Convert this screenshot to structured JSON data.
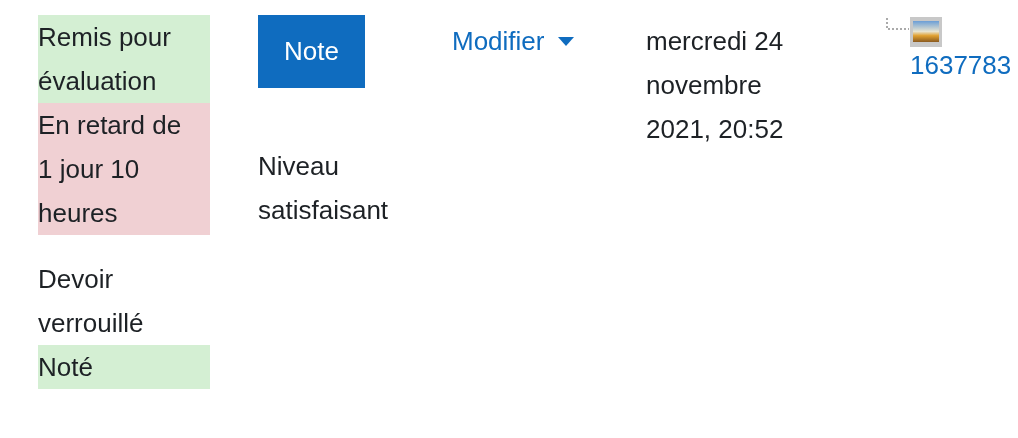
{
  "status_groups": [
    [
      {
        "text": "Remis pour évaluation",
        "color": "#d4efd3"
      },
      {
        "text": "En retard de 1 jour 10 heures",
        "color": "#f0d0d3"
      }
    ],
    [
      {
        "text": "Devoir verrouillé"
      },
      {
        "text": "Noté",
        "color": "#d4efd3"
      }
    ]
  ],
  "grade": {
    "button": "Note",
    "feedback": "Niveau satisfaisant"
  },
  "edit_menu": {
    "label": "Modifier"
  },
  "last_modified": "mercredi 24 novembre 2021, 20:52",
  "file": {
    "name": "1637783"
  }
}
